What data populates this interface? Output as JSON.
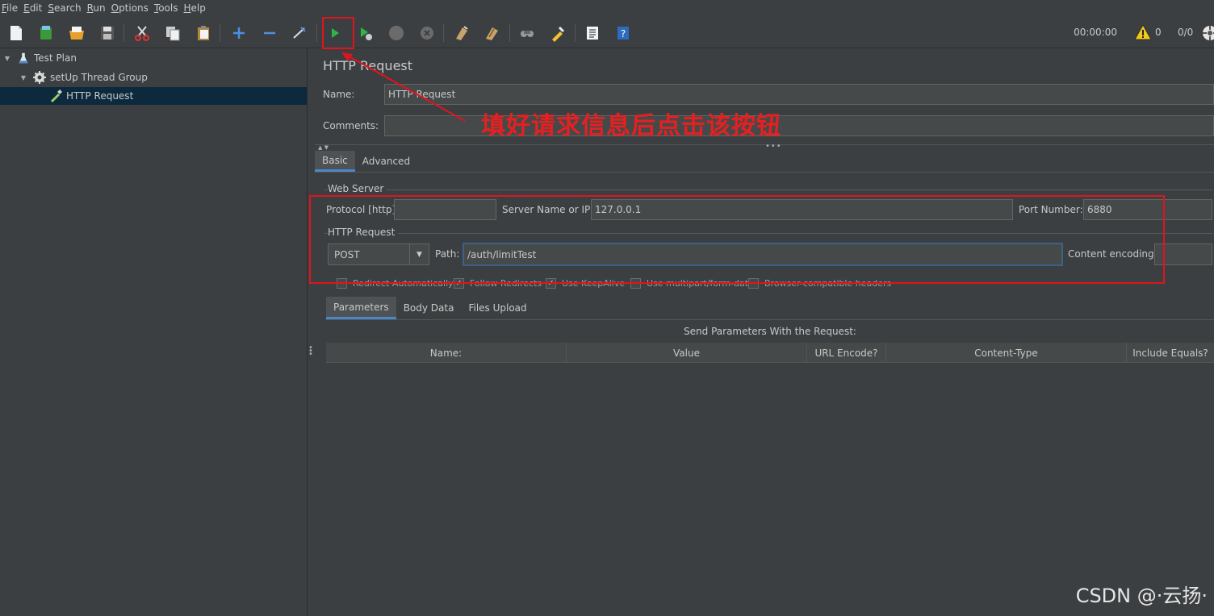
{
  "menu": [
    {
      "u": "F",
      "rest": "ile"
    },
    {
      "u": "E",
      "rest": "dit"
    },
    {
      "u": "S",
      "rest": "earch"
    },
    {
      "u": "R",
      "rest": "un"
    },
    {
      "u": "O",
      "rest": "ptions"
    },
    {
      "u": "T",
      "rest": "ools"
    },
    {
      "u": "H",
      "rest": "elp"
    }
  ],
  "toolbar": {
    "timer": "00:00:00",
    "warning_count": "0",
    "thread_count": "0/0"
  },
  "tree": {
    "test_plan": "Test Plan",
    "thread_group": "setUp Thread Group",
    "http_request": "HTTP Request"
  },
  "form": {
    "title": "HTTP Request",
    "name_label": "Name:",
    "name_value": "HTTP Request",
    "comments_label": "Comments:",
    "comments_value": "",
    "tabs": [
      "Basic",
      "Advanced"
    ],
    "web_server_title": "Web Server",
    "protocol_label": "Protocol [http]:",
    "protocol_value": "",
    "server_label": "Server Name or IP:",
    "server_value": "127.0.0.1",
    "port_label": "Port Number:",
    "port_value": "6880",
    "http_request_title": "HTTP Request",
    "method": "POST",
    "path_label": "Path:",
    "path_value": "/auth/limitTest",
    "encoding_label": "Content encoding:",
    "encoding_value": "",
    "checkboxes": [
      {
        "label": "Redirect Automatically",
        "checked": false
      },
      {
        "label": "Follow Redirects",
        "checked": true
      },
      {
        "label": "Use KeepAlive",
        "checked": true
      },
      {
        "label": "Use multipart/form-data",
        "checked": false
      },
      {
        "label": "Browser-compatible headers",
        "checked": false
      }
    ],
    "subtabs": [
      "Parameters",
      "Body Data",
      "Files Upload"
    ],
    "params_caption": "Send Parameters With the Request:",
    "columns": [
      "Name:",
      "Value",
      "URL Encode?",
      "Content-Type",
      "Include Equals?"
    ]
  },
  "annotation": {
    "text": "填好请求信息后点击该按钮",
    "color": "#e62020"
  },
  "watermark": "CSDN @·云扬·",
  "colors": {
    "background": "#3c3f41",
    "selected": "#0d293e",
    "accent": "#4a88c7",
    "annotation_red": "#e0141e"
  }
}
